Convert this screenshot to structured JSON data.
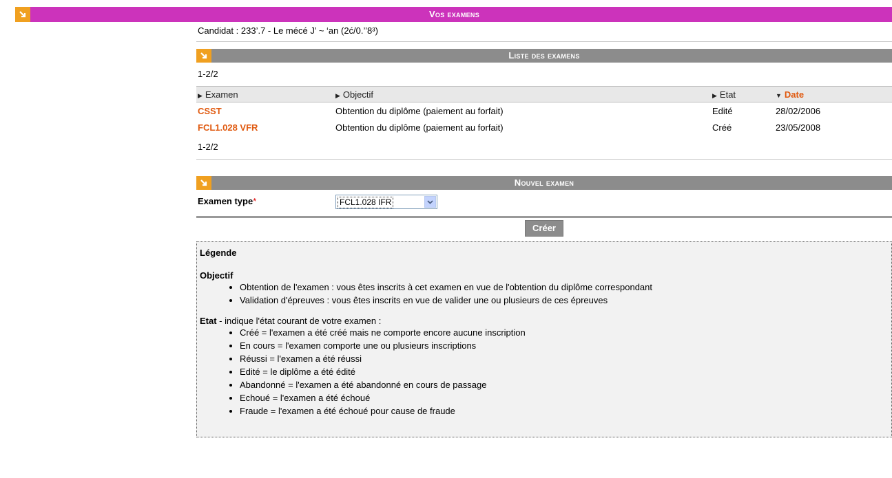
{
  "header": {
    "title": "Vos examens"
  },
  "candidat": {
    "label": "Candidat : 233’.7 - Le   mécé J’ ~ ‘an (2ć/0.’’8³)"
  },
  "exam_list": {
    "title": "Liste des examens",
    "pager_top": "1-2/2",
    "pager_bottom": "1-2/2",
    "columns": {
      "examen": "Examen",
      "objectif": "Objectif",
      "etat": "Etat",
      "date": "Date"
    },
    "rows": [
      {
        "examen": "CSST",
        "objectif": "Obtention du diplôme (paiement au forfait)",
        "etat": "Edité",
        "date": "28/02/2006"
      },
      {
        "examen": "FCL1.028 VFR",
        "objectif": "Obtention du diplôme (paiement au forfait)",
        "etat": "Créé",
        "date": "23/05/2008"
      }
    ]
  },
  "new_exam": {
    "title": "Nouvel examen",
    "type_label": "Examen type",
    "required_mark": "*",
    "type_value": "FCL1.028 IFR",
    "create_label": "Créer"
  },
  "legend": {
    "title": "Légende",
    "objectif_title": "Objectif",
    "objectif_items": [
      "Obtention de l'examen : vous êtes inscrits à cet examen en vue de l'obtention du diplôme correspondant",
      "Validation d'épreuves : vous êtes inscrits en vue de valider une ou plusieurs de ces épreuves"
    ],
    "etat_title": "Etat",
    "etat_desc": " - indique l'état courant de votre examen :",
    "etat_items": [
      "Créé = l'examen a été créé mais ne comporte encore aucune inscription",
      "En cours = l'examen comporte une ou plusieurs inscriptions",
      "Réussi = l'examen a été réussi",
      "Edité = le diplôme a été édité",
      "Abandonné = l'examen a été abandonné en cours de passage",
      "Echoué = l'examen a été échoué",
      "Fraude = l'examen a été échoué pour cause de fraude"
    ]
  },
  "colors": {
    "header": "#cc33bb",
    "section": "#8c8c8c",
    "link": "#e05a10",
    "icon": "#f0a020"
  }
}
